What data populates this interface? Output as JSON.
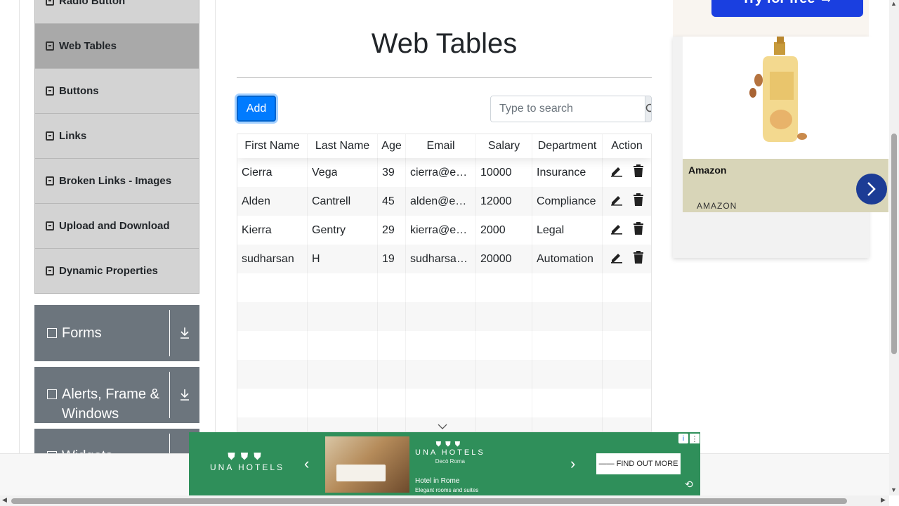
{
  "sidebar": {
    "items": [
      {
        "label": "Radio Button"
      },
      {
        "label": "Web Tables"
      },
      {
        "label": "Buttons"
      },
      {
        "label": "Links"
      },
      {
        "label": "Broken Links - Images"
      },
      {
        "label": "Upload and Download"
      },
      {
        "label": "Dynamic Properties"
      }
    ],
    "groups": [
      {
        "label": "Forms"
      },
      {
        "label": "Alerts, Frame & Windows"
      },
      {
        "label": "Widgets"
      }
    ]
  },
  "main": {
    "title": "Web Tables",
    "add_label": "Add",
    "search_placeholder": "Type to search",
    "columns": [
      "First Name",
      "Last Name",
      "Age",
      "Email",
      "Salary",
      "Department",
      "Action"
    ],
    "rows": [
      {
        "first": "Cierra",
        "last": "Vega",
        "age": "39",
        "email": "cierra@example.com",
        "salary": "10000",
        "dept": "Insurance"
      },
      {
        "first": "Alden",
        "last": "Cantrell",
        "age": "45",
        "email": "alden@example.com",
        "salary": "12000",
        "dept": "Compliance"
      },
      {
        "first": "Kierra",
        "last": "Gentry",
        "age": "29",
        "email": "kierra@example.com",
        "salary": "2000",
        "dept": "Legal"
      },
      {
        "first": "sudharsan",
        "last": "H",
        "age": "19",
        "email": "sudharsan@example.com",
        "salary": "20000",
        "dept": "Automation"
      }
    ]
  },
  "ad_right": {
    "cta": "Try for free →",
    "brand": "Amazon",
    "sub": "AMAZON"
  },
  "banner": {
    "logo": "UNA HOTELS",
    "brand": "UNA HOTELS",
    "location": "Decò Roma",
    "line1": "Hotel in Rome",
    "line2": "Elegant rooms and suites",
    "cta": "—— FIND OUT MORE"
  },
  "colors": {
    "primary": "#007bff",
    "sidebar_item": "#d3d3d3",
    "sidebar_active": "#a9a9a9",
    "group_bg": "#6c757d",
    "banner_bg": "#2f8f5a"
  }
}
